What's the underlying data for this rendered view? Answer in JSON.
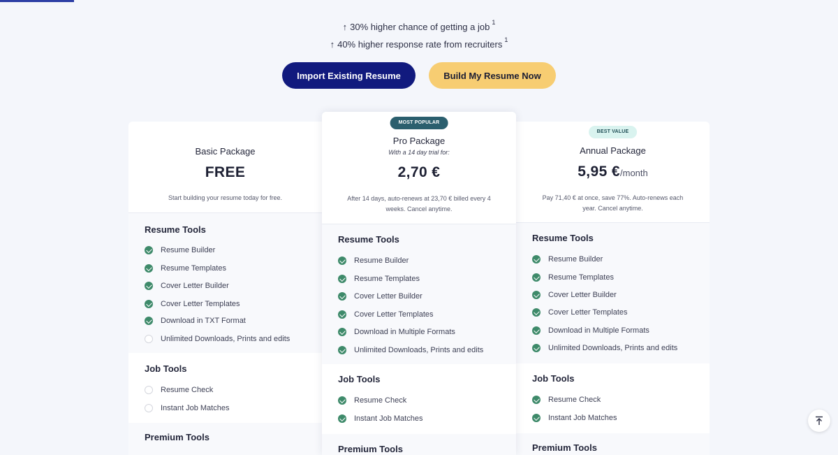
{
  "benefits": [
    {
      "text": "30% higher chance of getting a job",
      "sup": "1"
    },
    {
      "text": "40% higher response rate from recruiters",
      "sup": "1"
    }
  ],
  "buttons": {
    "import": "Import Existing Resume",
    "build": "Build My Resume Now"
  },
  "colors": {
    "import_bg": "#111a7e",
    "build_bg": "#f7cd72",
    "check": "#3e8a6a",
    "popular_badge": "#2b5f6e",
    "value_badge": "#d9f3ef"
  },
  "packages": {
    "basic": {
      "name": "Basic Package",
      "price": "FREE",
      "note": "Start building your resume today for free.",
      "sections": [
        {
          "title": "Resume Tools",
          "features": [
            {
              "label": "Resume Builder",
              "included": true
            },
            {
              "label": "Resume Templates",
              "included": true
            },
            {
              "label": "Cover Letter Builder",
              "included": true
            },
            {
              "label": "Cover Letter Templates",
              "included": true
            },
            {
              "label": "Download in TXT Format",
              "included": true
            },
            {
              "label": "Unlimited Downloads, Prints and edits",
              "included": false
            }
          ]
        },
        {
          "title": "Job Tools",
          "features": [
            {
              "label": "Resume Check",
              "included": false
            },
            {
              "label": "Instant Job Matches",
              "included": false
            }
          ]
        },
        {
          "title": "Premium Tools",
          "features": []
        }
      ]
    },
    "pro": {
      "badge": "MOST POPULAR",
      "name": "Pro Package",
      "subtitle": "With a 14 day trial for:",
      "price": "2,70 €",
      "note": "After 14 days, auto-renews at 23,70 € billed every 4 weeks. Cancel anytime.",
      "sections": [
        {
          "title": "Resume Tools",
          "features": [
            {
              "label": "Resume Builder",
              "included": true
            },
            {
              "label": "Resume Templates",
              "included": true
            },
            {
              "label": "Cover Letter Builder",
              "included": true
            },
            {
              "label": "Cover Letter Templates",
              "included": true
            },
            {
              "label": "Download in Multiple Formats",
              "included": true
            },
            {
              "label": "Unlimited Downloads, Prints and edits",
              "included": true
            }
          ]
        },
        {
          "title": "Job Tools",
          "features": [
            {
              "label": "Resume Check",
              "included": true
            },
            {
              "label": "Instant Job Matches",
              "included": true
            }
          ]
        },
        {
          "title": "Premium Tools",
          "features": []
        }
      ]
    },
    "annual": {
      "badge": "BEST VALUE",
      "name": "Annual Package",
      "price": "5,95 €",
      "price_unit": "/month",
      "note": "Pay 71,40 € at once, save 77%. Auto-renews each year. Cancel anytime.",
      "sections": [
        {
          "title": "Resume Tools",
          "features": [
            {
              "label": "Resume Builder",
              "included": true
            },
            {
              "label": "Resume Templates",
              "included": true
            },
            {
              "label": "Cover Letter Builder",
              "included": true
            },
            {
              "label": "Cover Letter Templates",
              "included": true
            },
            {
              "label": "Download in Multiple Formats",
              "included": true
            },
            {
              "label": "Unlimited Downloads, Prints and edits",
              "included": true
            }
          ]
        },
        {
          "title": "Job Tools",
          "features": [
            {
              "label": "Resume Check",
              "included": true
            },
            {
              "label": "Instant Job Matches",
              "included": true
            }
          ]
        },
        {
          "title": "Premium Tools",
          "features": []
        }
      ]
    }
  }
}
